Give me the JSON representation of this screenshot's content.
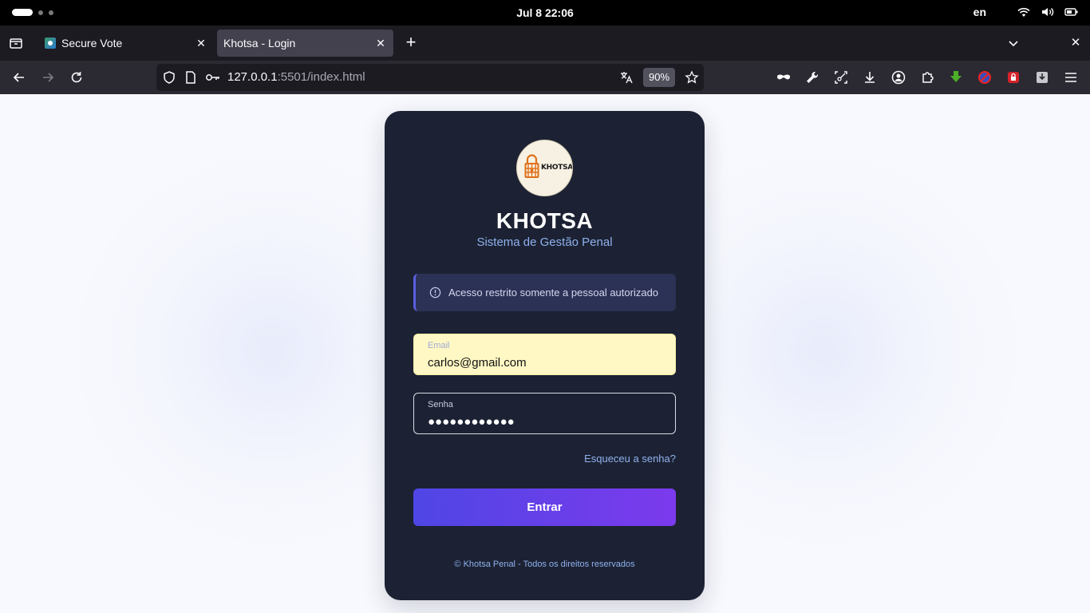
{
  "os": {
    "datetime": "Jul 8  22:06",
    "language": "en"
  },
  "tabs": [
    {
      "title": "Secure Vote",
      "close": "✕"
    },
    {
      "title": "Khotsa - Login",
      "close": "✕"
    }
  ],
  "tab_strip": {
    "new_tab": "+",
    "close_window": "✕"
  },
  "urlbar": {
    "host": "127.0.0.1",
    "path": ":5501/index.html",
    "zoom": "90%"
  },
  "login": {
    "logo_text": "KHOTSA",
    "title": "KHOTSA",
    "subtitle": "Sistema de Gestão Penal",
    "notice": "Acesso restrito somente a pessoal autorizado",
    "email": {
      "label": "Email",
      "value": "carlos@gmail.com"
    },
    "password": {
      "label": "Senha",
      "value": "●●●●●●●●●●●●"
    },
    "forgot": "Esqueceu a senha?",
    "submit": "Entrar",
    "footer": "© Khotsa Penal - Todos os direitos reservados"
  },
  "colors": {
    "card_bg": "#1c2233",
    "accent_start": "#4f46e5",
    "accent_end": "#7c3aed",
    "link": "#8fb0ee",
    "email_autofill_bg": "#fff8c4"
  }
}
